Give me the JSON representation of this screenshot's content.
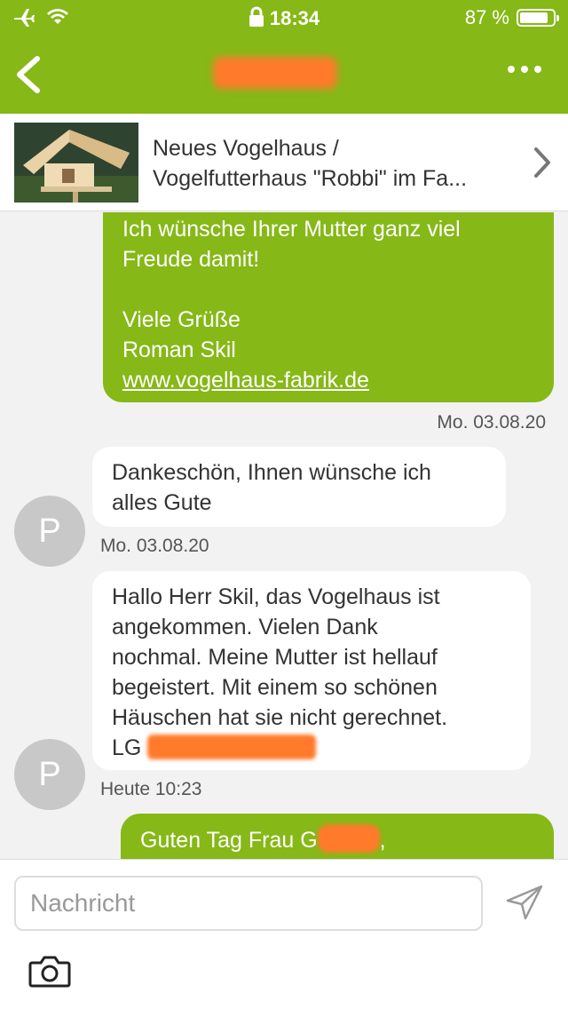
{
  "status_bar": {
    "time": "18:34",
    "battery_text": "87 %",
    "battery_level": 0.87,
    "icons": [
      "airplane-icon",
      "wifi-icon",
      "lock-icon",
      "battery-icon"
    ]
  },
  "nav": {
    "back_icon": "chevron-left-icon",
    "more_icon": "more-dots-icon"
  },
  "product": {
    "title_line1": "Neues Vogelhaus /",
    "title_line2": "Vogelfutterhaus \"Robbi\" im Fa..."
  },
  "messages": {
    "m1": {
      "line1": "Ich wünsche Ihrer Mutter ganz viel",
      "line2": "Freude damit!",
      "line3": "Viele Grüße",
      "line4": "Roman Skil",
      "link": "www.vogelhaus-fabrik.de",
      "time": "Mo. 03.08.20"
    },
    "m2": {
      "avatar": "P",
      "line1": "Dankeschön, Ihnen wünsche ich",
      "line2": "alles Gute",
      "time": "Mo. 03.08.20"
    },
    "m3": {
      "avatar": "P",
      "line1": "Hallo Herr Skil, das Vogelhaus ist",
      "line2": "angekommen. Vielen Dank",
      "line3": "nochmal. Meine Mutter ist hellauf",
      "line4": "begeistert. Mit einem so schönen",
      "line5": "Häuschen hat sie nicht gerechnet.",
      "line6": "LG",
      "time": "Heute 10:23"
    },
    "m4": {
      "line1_prefix": "Guten Tag Frau G",
      "line1_suffix": ","
    }
  },
  "composer": {
    "placeholder": "Nachricht",
    "send_icon": "send-icon",
    "camera_icon": "camera-icon"
  },
  "colors": {
    "brand_green": "#86b817",
    "redaction_orange": "#ff7a2a",
    "background": "#f2f2f2"
  }
}
